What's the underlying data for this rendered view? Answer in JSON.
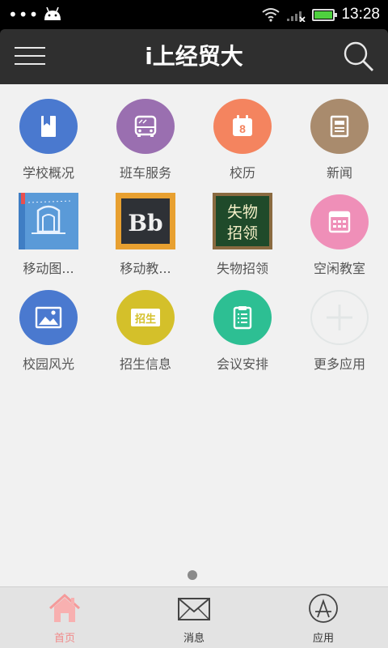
{
  "status_bar": {
    "time": "13:28",
    "dots": "•••"
  },
  "header": {
    "title": "i上经贸大"
  },
  "apps": [
    {
      "label": "学校概况",
      "icon": "book-icon",
      "color": "#4a79cf"
    },
    {
      "label": "班车服务",
      "icon": "bus-icon",
      "color": "#9a6fb0"
    },
    {
      "label": "校历",
      "icon": "calendar-icon",
      "color": "#f4845f",
      "icon_text": "8"
    },
    {
      "label": "新闻",
      "icon": "news-icon",
      "color": "#a98b6d"
    },
    {
      "label": "移动图...",
      "icon": "library-icon",
      "color": "#5a9ad8"
    },
    {
      "label": "移动教...",
      "icon": "blackboard-bb-icon",
      "color": "#e8a030",
      "icon_text": "Bb"
    },
    {
      "label": "失物招领",
      "icon": "lost-found-chalkboard-icon",
      "color": "#1f4a2a",
      "icon_text": [
        "失物",
        "招领"
      ]
    },
    {
      "label": "空闲教室",
      "icon": "classroom-grid-icon",
      "color": "#ef8fb8"
    },
    {
      "label": "校园风光",
      "icon": "picture-icon",
      "color": "#4a79cf"
    },
    {
      "label": "招生信息",
      "icon": "enrollment-icon",
      "color": "#d4c02a",
      "icon_text": "招生"
    },
    {
      "label": "会议安排",
      "icon": "clipboard-icon",
      "color": "#2dbf93"
    },
    {
      "label": "更多应用",
      "icon": "add-icon",
      "color": "#e2e6e6"
    }
  ],
  "tabs": [
    {
      "label": "首页",
      "icon": "home-icon",
      "active": true
    },
    {
      "label": "消息",
      "icon": "mail-icon",
      "active": false
    },
    {
      "label": "应用",
      "icon": "app-store-icon",
      "active": false
    }
  ],
  "colors": {
    "header_bg": "#2f2f2f",
    "main_bg": "#f1f1f1",
    "active_tab": "#f08a8a"
  }
}
